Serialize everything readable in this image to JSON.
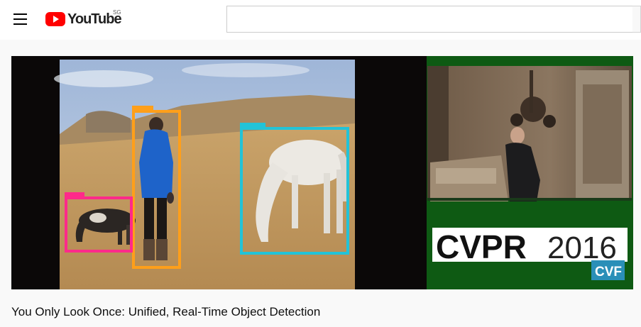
{
  "header": {
    "menu_icon": "hamburger-menu-icon",
    "logo_text": "YouTube",
    "region_code": "SG",
    "search_value": "",
    "brand_color": "#ff0000"
  },
  "video": {
    "title": "You Only Look Once: Unified, Real-Time Object Detection",
    "detections": [
      {
        "label": "person",
        "color": "#ff9f1a"
      },
      {
        "label": "dog",
        "color": "#ff2a8a"
      },
      {
        "label": "horse",
        "color": "#22c3d8"
      }
    ],
    "conference_name": "CVPR",
    "conference_year": "2016",
    "cvf_logo_text": "CVF"
  }
}
